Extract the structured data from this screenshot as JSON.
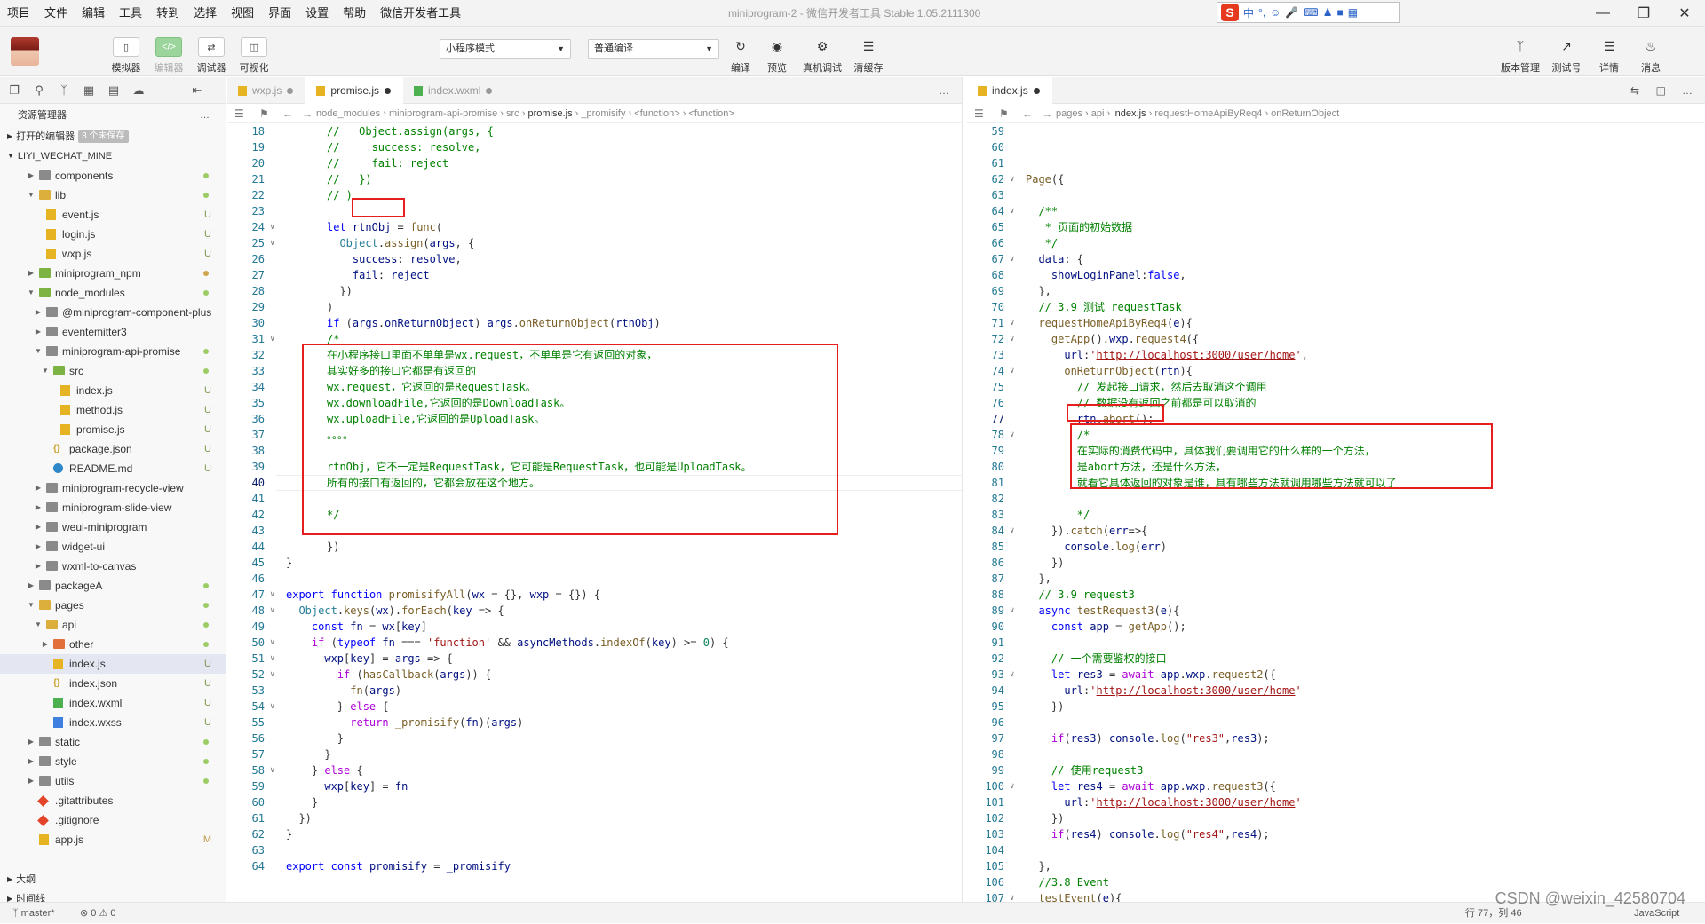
{
  "menu": [
    "项目",
    "文件",
    "编辑",
    "工具",
    "转到",
    "选择",
    "视图",
    "界面",
    "设置",
    "帮助",
    "微信开发者工具"
  ],
  "window_title": "miniprogram-2 - 微信开发者工具 Stable 1.05.2111300",
  "toolbar": {
    "simulator": "模拟器",
    "editor": "编辑器",
    "debugger": "调试器",
    "visual": "可视化",
    "mode_select": "小程序模式",
    "compile_select": "普通编译",
    "compile": "编译",
    "preview": "预览",
    "remote_debug": "真机调试",
    "clear_cache": "清缓存",
    "version": "版本管理",
    "test_account": "测试号",
    "details": "详情",
    "messages": "消息"
  },
  "ime": {
    "lang": "中",
    "punct": "°,"
  },
  "sidebar": {
    "title": "资源管理器",
    "open_editors": "打开的编辑器",
    "unsaved_badge": "3 个未保存",
    "root": "LIYI_WECHAT_MINE",
    "rows": [
      {
        "name": "components",
        "status": "dot"
      },
      {
        "name": "lib",
        "status": "dot"
      },
      {
        "name": "event.js",
        "status": "U"
      },
      {
        "name": "login.js",
        "status": "U"
      },
      {
        "name": "wxp.js",
        "status": "U"
      },
      {
        "name": "miniprogram_npm",
        "status": "dotm"
      },
      {
        "name": "node_modules",
        "status": "dot"
      },
      {
        "name": "@miniprogram-component-plus",
        "status": ""
      },
      {
        "name": "eventemitter3",
        "status": ""
      },
      {
        "name": "miniprogram-api-promise",
        "status": "dot"
      },
      {
        "name": "src",
        "status": "dot"
      },
      {
        "name": "index.js",
        "status": "U"
      },
      {
        "name": "method.js",
        "status": "U"
      },
      {
        "name": "promise.js",
        "status": "U"
      },
      {
        "name": "package.json",
        "status": "U"
      },
      {
        "name": "README.md",
        "status": "U"
      },
      {
        "name": "miniprogram-recycle-view",
        "status": ""
      },
      {
        "name": "miniprogram-slide-view",
        "status": ""
      },
      {
        "name": "weui-miniprogram",
        "status": ""
      },
      {
        "name": "widget-ui",
        "status": ""
      },
      {
        "name": "wxml-to-canvas",
        "status": ""
      },
      {
        "name": "packageA",
        "status": "dot"
      },
      {
        "name": "pages",
        "status": "dot"
      },
      {
        "name": "api",
        "status": "dot"
      },
      {
        "name": "other",
        "status": "dot"
      },
      {
        "name": "index.js",
        "status": "U"
      },
      {
        "name": "index.json",
        "status": "U"
      },
      {
        "name": "index.wxml",
        "status": "U"
      },
      {
        "name": "index.wxss",
        "status": "U"
      },
      {
        "name": "static",
        "status": "dot"
      },
      {
        "name": "style",
        "status": "dot"
      },
      {
        "name": "utils",
        "status": "dot"
      },
      {
        "name": ".gitattributes",
        "status": ""
      },
      {
        "name": ".gitignore",
        "status": ""
      },
      {
        "name": "app.js",
        "status": "M"
      }
    ],
    "outline": "大纲",
    "timeline": "时间线"
  },
  "left_editor": {
    "tabs": [
      "wxp.js",
      "promise.js",
      "index.wxml"
    ],
    "crumbs": [
      "node_modules",
      "miniprogram-api-promise",
      "src",
      "promise.js",
      "_promisify",
      "<function>",
      "<function>"
    ]
  },
  "right_editor": {
    "tabs": [
      "index.js"
    ],
    "crumbs": [
      "pages",
      "api",
      "index.js",
      "requestHomeApiByReq4",
      "onReturnObject"
    ]
  },
  "status": {
    "branch": "master*",
    "problems": "⊗ 0 ⚠ 0",
    "position": "行 77，列 46",
    "lang": "JavaScript"
  },
  "watermark": "CSDN @weixin_42580704"
}
